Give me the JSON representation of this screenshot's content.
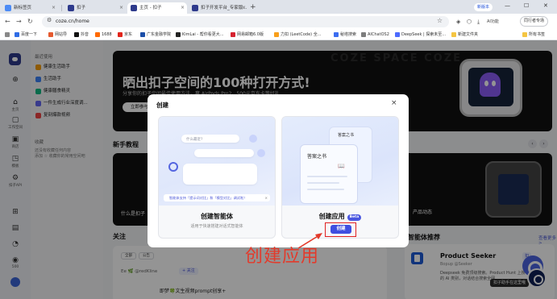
{
  "browser": {
    "tabs": [
      {
        "label": "新标签页"
      },
      {
        "label": "扣子"
      },
      {
        "label": "主页 - 扣子"
      },
      {
        "label": "扣子开发平台_专家版..."
      }
    ],
    "new_version_label": "新版本",
    "url": "coze.cn/home",
    "ai_label": "AI功能",
    "profile_label": "同行者专场",
    "bookmarks": [
      {
        "label": "百度一下",
        "color": "#2f6ce5"
      },
      {
        "label": "网站导",
        "color": "#e55a2f"
      },
      {
        "label": "抖音",
        "color": "#111111"
      },
      {
        "label": "1688",
        "color": "#ff6a00"
      },
      {
        "label": "京东",
        "color": "#e1251b"
      },
      {
        "label": "广东金融学院",
        "color": "#1b4ea8"
      },
      {
        "label": "KimLai - 帮你看更大...",
        "color": "#222222"
      },
      {
        "label": "网易邮箱6.0版",
        "color": "#d6232f"
      },
      {
        "label": "力扣 (LeetCode) 全...",
        "color": "#f89f1b"
      },
      {
        "label": "秘塔搜索",
        "color": "#3c6df0"
      },
      {
        "label": "AIChatOS2",
        "color": "#7d7d7d"
      },
      {
        "label": "DeepSeek | 探索未至...",
        "color": "#4d6bfe"
      },
      {
        "label": "新建文件夹",
        "color": "#f5c542"
      }
    ],
    "all_bookmarks_label": "所有书签"
  },
  "rail": {
    "items": [
      {
        "label": "",
        "icon": "plus-circle-icon"
      },
      {
        "label": "主页",
        "icon": "home-icon"
      },
      {
        "label": "工作空间",
        "icon": "folder-icon"
      },
      {
        "label": "商店",
        "icon": "store-icon"
      },
      {
        "label": "模板",
        "icon": "template-icon"
      },
      {
        "label": "扣子API",
        "icon": "api-icon"
      },
      {
        "label": "",
        "icon": "grid-icon"
      },
      {
        "label": "",
        "icon": "book-icon"
      },
      {
        "label": "",
        "icon": "bell-icon"
      },
      {
        "label": "500",
        "icon": "coin-icon"
      }
    ]
  },
  "sidebar": {
    "recent_heading": "最近使用",
    "recent": [
      {
        "label": "健康生活助手",
        "color": "#f59e0b"
      },
      {
        "label": "生活助手",
        "color": "#3b82f6"
      },
      {
        "label": "健康膳食精灵",
        "color": "#10b981"
      },
      {
        "label": "一件生成行业深度调...",
        "color": "#6366f1"
      },
      {
        "label": "复刻爆款视频",
        "color": "#ef4444"
      }
    ],
    "favorites_heading": "收藏",
    "favorites_note_1": "还没有收藏任何内容",
    "favorites_note_2": "添加 ☆ 收藏你的常用空间吧"
  },
  "banner": {
    "watermark": "COZE SPACE COZE",
    "title": "晒出扣子空间的100种打开方式!",
    "subtitle": "分享你的扣子空间最佳使用方法，赢 AirPods Pro2、500元京东卡等好礼",
    "button": "立即参与"
  },
  "tutorial": {
    "title": "新手教程",
    "left_caption": "什么是扣子",
    "right_caption": "产品动态"
  },
  "feed": {
    "title": "关注",
    "filters": [
      "全部",
      "公告"
    ],
    "user": "Ee 🌿 @redKline",
    "follow": "+ 关注",
    "post_title": "即梦🍀文生视频prompt创享+"
  },
  "recommend": {
    "title": "智能体推荐",
    "more": "查看更多 >",
    "name": "Product Seeker",
    "by": "Bopup @Seeker",
    "desc": "Deepseek 免费顶级搜索。Product Hunt 上搜的 AI 类别，对话结合搜索全网...",
    "open": "扣"
  },
  "help_tip": "扣子助手在这里哦",
  "modal": {
    "title": "创建",
    "close": "×",
    "agent": {
      "input_placeholder": "什么最近?",
      "hint": "智能体支持「提示词对比」和「模型对比」调试啦！",
      "hint_close": "×",
      "name": "创建智能体",
      "desc": "适用于快速搭建对话式智能体"
    },
    "app": {
      "card_title": "答案之书",
      "card_back_title": "答案之书",
      "name": "创建应用",
      "badge": "Beta",
      "create_button": "创建"
    }
  },
  "annotation": {
    "text": "创建应用",
    "color": "#e33a2b"
  }
}
